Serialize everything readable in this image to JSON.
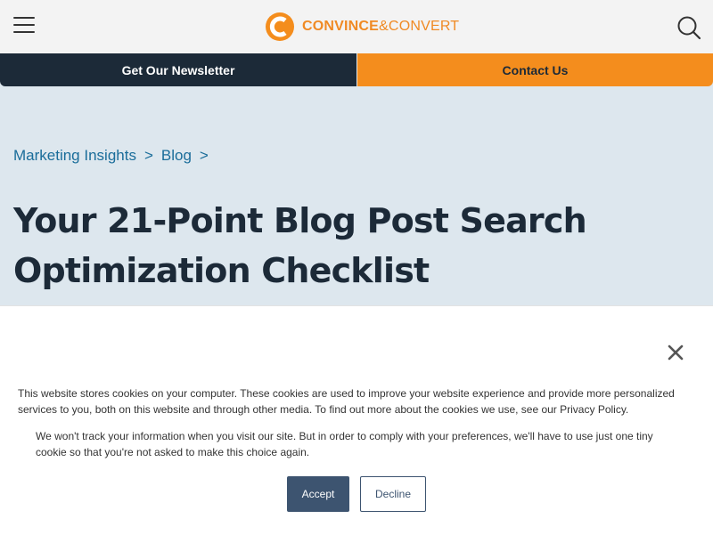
{
  "header": {
    "logo_text_bold": "CONVINCE",
    "logo_text_rest": "&CONVERT",
    "menu_icon": "hamburger-icon",
    "search_icon": "search-icon"
  },
  "cta": {
    "newsletter_label": "Get Our Newsletter",
    "contact_label": "Contact Us"
  },
  "breadcrumb": {
    "items": [
      {
        "label": "Marketing Insights"
      },
      {
        "label": "Blog"
      }
    ],
    "separator": ">"
  },
  "article": {
    "title": "Your 21-Point Blog Post Search Optimization Checklist"
  },
  "cookie_banner": {
    "text_main": "This website stores cookies on your computer. These cookies are used to improve your website experience and provide more personalized services to you, both on this website and through other media. To find out more about the cookies we use, see our Privacy Policy.",
    "text_secondary": "We won't track your information when you visit our site. But in order to comply with your preferences, we'll have to use just one tiny cookie so that you're not asked to make this choice again.",
    "accept_label": "Accept",
    "decline_label": "Decline",
    "close_icon": "close-icon"
  },
  "colors": {
    "brand_orange": "#f48d1d",
    "navy": "#1c2a38",
    "page_bg": "#dde7ee",
    "link_blue": "#1a6d9a",
    "button_slate": "#3d5470"
  }
}
